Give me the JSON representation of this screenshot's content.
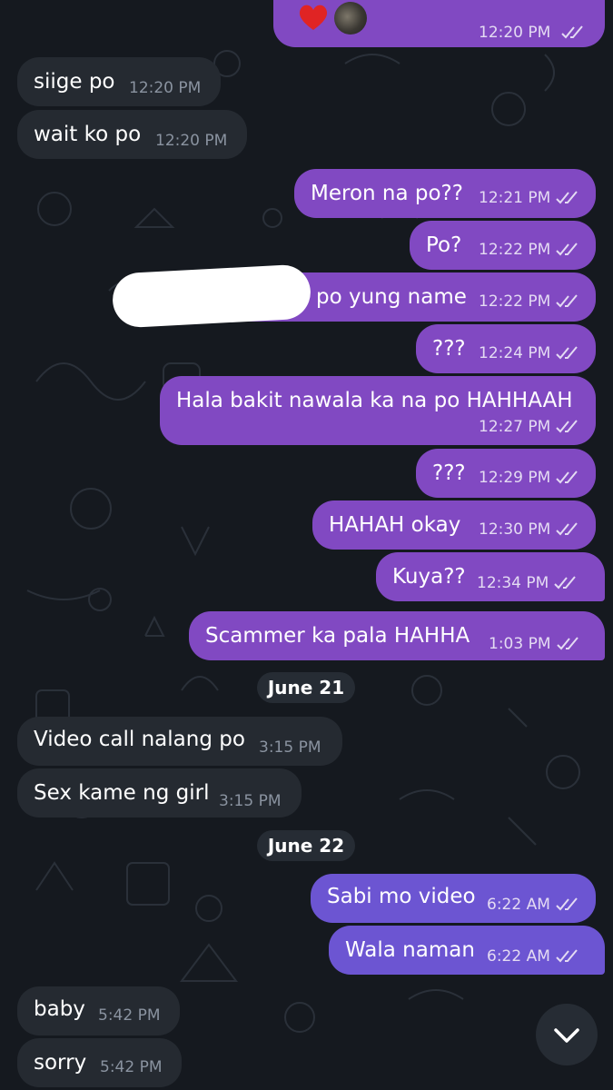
{
  "colors": {
    "background": "#15191f",
    "incoming_bubble": "#252a31",
    "outgoing_bubble": "#8149c2",
    "outgoing_bubble_latest": "#6c55d2",
    "date_pill": "#262c34"
  },
  "top_message": {
    "reactions": [
      "heart-icon",
      "avatar"
    ],
    "time": "12:20 PM"
  },
  "messages": [
    {
      "dir": "in",
      "text": "siige po",
      "time": "12:20 PM"
    },
    {
      "dir": "in",
      "text": "wait ko po",
      "time": "12:20 PM"
    },
    {
      "dir": "out",
      "text": "Meron na po??",
      "time": "12:21 PM"
    },
    {
      "dir": "out",
      "text": "Po?",
      "time": "12:22 PM"
    },
    {
      "dir": "out",
      "text": "po yung name",
      "time": "12:22 PM"
    },
    {
      "dir": "out",
      "text": "???",
      "time": "12:24 PM"
    },
    {
      "dir": "out",
      "text": "Hala bakit nawala ka na po HAHHAAH",
      "time": "12:27 PM"
    },
    {
      "dir": "out",
      "text": "???",
      "time": "12:29 PM"
    },
    {
      "dir": "out",
      "text": "HAHAH okay",
      "time": "12:30 PM"
    },
    {
      "dir": "out",
      "text": "Kuya??",
      "time": "12:34 PM"
    },
    {
      "dir": "out",
      "text": "Scammer ka pala HAHHA",
      "time": "1:03 PM"
    },
    {
      "dir": "in",
      "text": "Video call nalang po",
      "time": "3:15 PM"
    },
    {
      "dir": "in",
      "text": "Sex kame ng girl",
      "time": "3:15 PM"
    },
    {
      "dir": "out",
      "text": "Sabi mo video",
      "time": "6:22 AM"
    },
    {
      "dir": "out",
      "text": "Wala naman",
      "time": "6:22 AM"
    },
    {
      "dir": "in",
      "text": "baby",
      "time": "5:42 PM"
    },
    {
      "dir": "in",
      "text": "sorry",
      "time": "5:42 PM"
    }
  ],
  "dates": [
    "June 21",
    "June 22"
  ],
  "scroll_button_icon": "chevron-down-icon"
}
